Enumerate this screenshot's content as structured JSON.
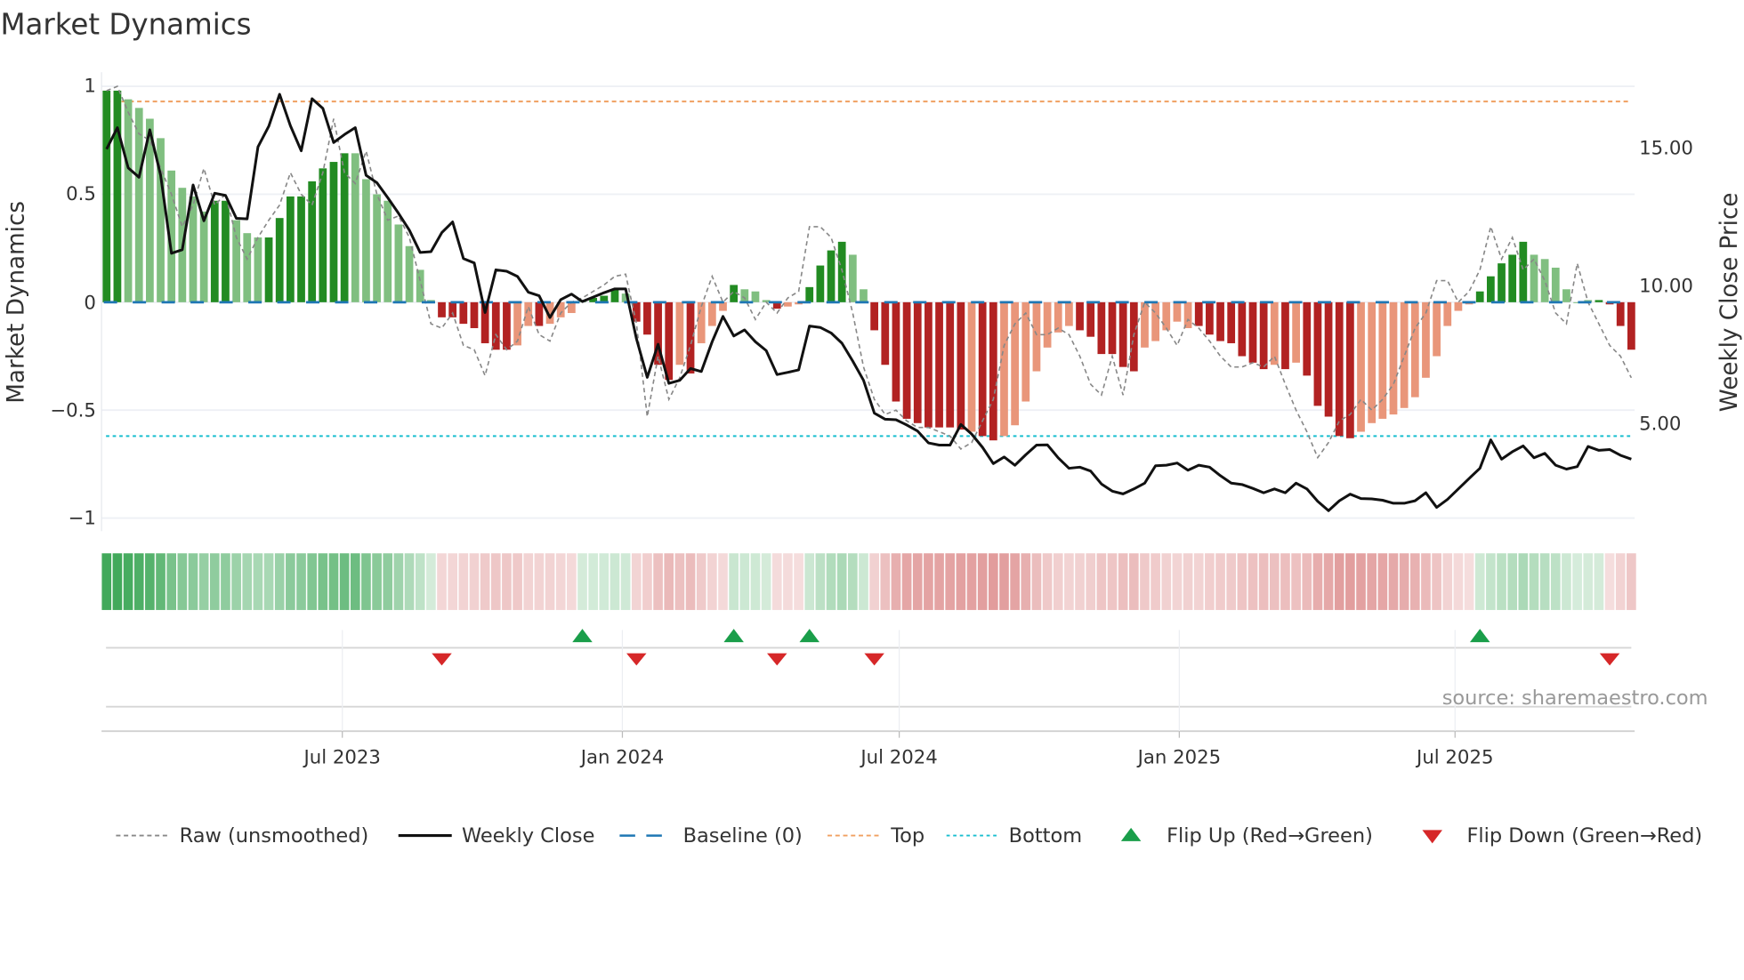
{
  "title": "Market Dynamics",
  "source": "source: sharemaestro.com",
  "colors": {
    "bar_up_strong": "#228b22",
    "bar_up_weak": "#80bf80",
    "bar_down_strong": "#b22222",
    "bar_down_weak": "#e9967a",
    "raw": "#888888",
    "close": "#111111",
    "baseline": "#1f77b4",
    "top": "#f0a060",
    "bottom": "#17becf",
    "flip_up": "#1a9e4a",
    "flip_down": "#d62728"
  },
  "chart_data": {
    "type": "bar",
    "title": "Market Dynamics",
    "ylabel": "Market Dynamics",
    "y2label": "Weekly Close Price",
    "ylim": [
      -1.05,
      1.05
    ],
    "y2lim": [
      1.17,
      17.62
    ],
    "yticks": [
      {
        "v": 1,
        "label": "1"
      },
      {
        "v": 0.5,
        "label": "0.5"
      },
      {
        "v": 0,
        "label": "0"
      },
      {
        "v": -0.5,
        "label": "−0.5"
      },
      {
        "v": -1,
        "label": "−1"
      }
    ],
    "y2ticks": [
      {
        "v": 15,
        "label": "15.00"
      },
      {
        "v": 10,
        "label": "10.00"
      },
      {
        "v": 5,
        "label": "5.00"
      }
    ],
    "xticks": [
      {
        "i": 21.8,
        "label": "Jul 2023"
      },
      {
        "i": 47.7,
        "label": "Jan 2024"
      },
      {
        "i": 73.3,
        "label": "Jul 2024"
      },
      {
        "i": 99.2,
        "label": "Jan 2025"
      },
      {
        "i": 124.7,
        "label": "Jul 2025"
      }
    ],
    "grid": true,
    "top_level": 0.93,
    "bottom_level": -0.62,
    "baseline": 0,
    "dynamics": [
      0.98,
      0.98,
      0.94,
      0.9,
      0.85,
      0.76,
      0.61,
      0.53,
      0.49,
      0.42,
      0.47,
      0.47,
      0.38,
      0.32,
      0.3,
      0.3,
      0.39,
      0.49,
      0.49,
      0.56,
      0.62,
      0.65,
      0.69,
      0.69,
      0.57,
      0.5,
      0.47,
      0.36,
      0.26,
      0.15,
      0.01,
      -0.07,
      -0.07,
      -0.1,
      -0.12,
      -0.19,
      -0.22,
      -0.22,
      -0.2,
      -0.11,
      -0.11,
      -0.1,
      -0.07,
      -0.05,
      0.01,
      0.02,
      0.03,
      0.06,
      0.04,
      -0.09,
      -0.15,
      -0.29,
      -0.36,
      -0.29,
      -0.33,
      -0.19,
      -0.11,
      -0.04,
      0.08,
      0.06,
      0.05,
      0.01,
      -0.03,
      -0.02,
      -0.01,
      0.07,
      0.17,
      0.24,
      0.28,
      0.22,
      0.06,
      -0.13,
      -0.29,
      -0.46,
      -0.54,
      -0.56,
      -0.58,
      -0.58,
      -0.58,
      -0.59,
      -0.6,
      -0.62,
      -0.64,
      -0.62,
      -0.57,
      -0.46,
      -0.32,
      -0.21,
      -0.14,
      -0.11,
      -0.13,
      -0.16,
      -0.24,
      -0.24,
      -0.3,
      -0.32,
      -0.21,
      -0.18,
      -0.13,
      -0.09,
      -0.12,
      -0.11,
      -0.15,
      -0.18,
      -0.19,
      -0.25,
      -0.28,
      -0.31,
      -0.29,
      -0.31,
      -0.28,
      -0.34,
      -0.48,
      -0.53,
      -0.62,
      -0.63,
      -0.6,
      -0.56,
      -0.54,
      -0.52,
      -0.49,
      -0.44,
      -0.35,
      -0.25,
      -0.11,
      -0.04,
      -0.01,
      0.05,
      0.12,
      0.18,
      0.22,
      0.28,
      0.22,
      0.2,
      0.16,
      0.06,
      0.0,
      0.01,
      0.01,
      -0.01,
      -0.11,
      -0.22
    ],
    "strong": [
      1,
      1,
      0,
      0,
      0,
      0,
      0,
      0,
      0,
      0,
      1,
      1,
      0,
      0,
      0,
      1,
      1,
      1,
      1,
      1,
      1,
      1,
      1,
      0,
      0,
      0,
      0,
      0,
      0,
      0,
      0,
      1,
      1,
      1,
      1,
      1,
      1,
      1,
      0,
      0,
      1,
      0,
      0,
      0,
      0,
      1,
      1,
      1,
      0,
      1,
      1,
      1,
      1,
      0,
      1,
      0,
      0,
      0,
      1,
      0,
      0,
      0,
      1,
      0,
      0,
      1,
      1,
      1,
      1,
      0,
      0,
      1,
      1,
      1,
      1,
      1,
      1,
      1,
      1,
      1,
      0,
      1,
      1,
      0,
      0,
      0,
      0,
      0,
      0,
      0,
      1,
      1,
      1,
      1,
      1,
      1,
      0,
      0,
      0,
      0,
      0,
      1,
      1,
      1,
      1,
      1,
      1,
      1,
      0,
      1,
      0,
      1,
      1,
      1,
      1,
      1,
      0,
      0,
      0,
      0,
      0,
      0,
      0,
      0,
      0,
      0,
      0,
      1,
      1,
      1,
      1,
      1,
      0,
      0,
      0,
      0,
      0,
      0,
      1,
      1,
      1,
      1
    ],
    "raw": [
      0.98,
      1.0,
      0.88,
      0.78,
      0.75,
      0.62,
      0.5,
      0.35,
      0.45,
      0.62,
      0.45,
      0.5,
      0.3,
      0.2,
      0.3,
      0.38,
      0.45,
      0.6,
      0.5,
      0.45,
      0.6,
      0.85,
      0.6,
      0.55,
      0.7,
      0.5,
      0.38,
      0.4,
      0.3,
      0.1,
      -0.1,
      -0.12,
      -0.05,
      -0.2,
      -0.22,
      -0.34,
      -0.15,
      -0.22,
      -0.18,
      -0.02,
      -0.15,
      -0.18,
      -0.05,
      0.0,
      0.02,
      0.05,
      0.08,
      0.12,
      0.13,
      -0.1,
      -0.53,
      -0.25,
      -0.45,
      -0.35,
      -0.2,
      -0.02,
      0.12,
      0.0,
      0.05,
      0.02,
      -0.08,
      0.0,
      -0.05,
      0.02,
      0.05,
      0.35,
      0.35,
      0.3,
      0.15,
      -0.05,
      -0.3,
      -0.45,
      -0.52,
      -0.5,
      -0.55,
      -0.58,
      -0.58,
      -0.6,
      -0.62,
      -0.68,
      -0.65,
      -0.55,
      -0.45,
      -0.2,
      -0.1,
      -0.05,
      -0.15,
      -0.15,
      -0.12,
      -0.15,
      -0.25,
      -0.38,
      -0.43,
      -0.25,
      -0.43,
      -0.15,
      0.0,
      -0.05,
      -0.12,
      -0.2,
      -0.08,
      -0.12,
      -0.18,
      -0.25,
      -0.3,
      -0.3,
      -0.28,
      -0.3,
      -0.25,
      -0.38,
      -0.5,
      -0.6,
      -0.72,
      -0.65,
      -0.55,
      -0.52,
      -0.45,
      -0.5,
      -0.45,
      -0.38,
      -0.25,
      -0.12,
      -0.05,
      0.1,
      0.1,
      0.0,
      0.05,
      0.15,
      0.35,
      0.2,
      0.3,
      0.15,
      0.2,
      0.1,
      -0.05,
      -0.1,
      0.18,
      0.0,
      -0.1,
      -0.2,
      -0.25,
      -0.35
    ],
    "close": [
      14.95,
      15.73,
      14.27,
      13.93,
      15.65,
      14.0,
      11.17,
      11.3,
      13.65,
      12.35,
      13.35,
      13.27,
      12.44,
      12.42,
      15.03,
      15.78,
      16.94,
      15.8,
      14.89,
      16.78,
      16.43,
      15.19,
      15.48,
      15.73,
      14.0,
      13.73,
      13.19,
      12.62,
      12.01,
      11.2,
      11.23,
      11.92,
      12.31,
      10.98,
      10.82,
      9.02,
      10.57,
      10.52,
      10.33,
      9.76,
      9.63,
      8.84,
      9.49,
      9.69,
      9.42,
      9.58,
      9.74,
      9.88,
      9.88,
      8.07,
      6.67,
      7.87,
      6.45,
      6.56,
      6.99,
      6.88,
      7.96,
      8.88,
      8.17,
      8.39,
      7.96,
      7.64,
      6.77,
      6.85,
      6.94,
      8.53,
      8.48,
      8.28,
      7.91,
      7.26,
      6.56,
      5.37,
      5.15,
      5.13,
      4.94,
      4.72,
      4.29,
      4.21,
      4.21,
      4.96,
      4.61,
      4.13,
      3.54,
      3.78,
      3.48,
      3.86,
      4.21,
      4.22,
      3.75,
      3.37,
      3.41,
      3.27,
      2.8,
      2.54,
      2.44,
      2.62,
      2.83,
      3.46,
      3.48,
      3.56,
      3.3,
      3.48,
      3.41,
      3.1,
      2.83,
      2.78,
      2.64,
      2.48,
      2.62,
      2.48,
      2.83,
      2.62,
      2.17,
      1.83,
      2.19,
      2.43,
      2.27,
      2.26,
      2.21,
      2.1,
      2.1,
      2.19,
      2.48,
      1.95,
      2.24,
      2.62,
      3.0,
      3.37,
      4.4,
      3.7,
      3.97,
      4.18,
      3.75,
      3.91,
      3.48,
      3.34,
      3.43,
      4.16,
      4.02,
      4.05,
      3.84,
      3.7
    ],
    "flips_up": [
      44,
      58,
      65,
      127
    ],
    "flips_down": [
      31,
      49,
      62,
      71,
      139
    ],
    "legend": {
      "placement": "bottom",
      "items": [
        "Raw (unsmoothed)",
        "Weekly Close",
        "Baseline (0)",
        "Top",
        "Bottom",
        "Flip Up (Red→Green)",
        "Flip Down (Green→Red)"
      ]
    }
  }
}
